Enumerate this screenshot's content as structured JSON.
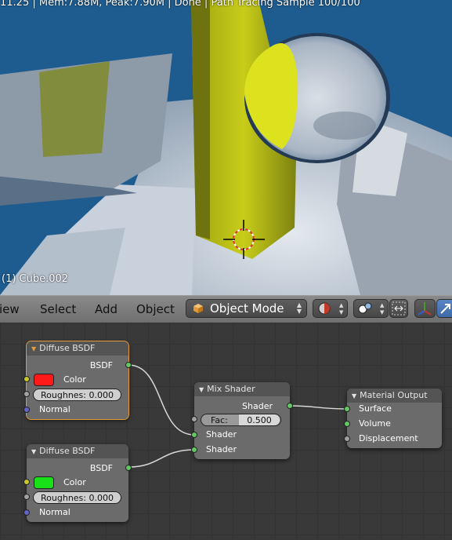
{
  "viewport": {
    "status_text": "11.25 | Mem:7.88M, Peak:7.90M | Done | Path Tracing Sample 100/100",
    "object_label": "(1) Cube.002"
  },
  "header": {
    "menus": [
      "iew",
      "Select",
      "Add",
      "Object"
    ],
    "mode": "Object Mode",
    "icons": [
      "cube-icon",
      "viewport-shading-icon",
      "pivot-icon",
      "snap-icon",
      "manipulator-icon",
      "translate-icon"
    ]
  },
  "nodes": {
    "diffuse1": {
      "title": "Diffuse BSDF",
      "output": "BSDF",
      "color_label": "Color",
      "color": "#ff1a1a",
      "roughness": "Roughnes: 0.000",
      "normal": "Normal"
    },
    "diffuse2": {
      "title": "Diffuse BSDF",
      "output": "BSDF",
      "color_label": "Color",
      "color": "#18e018",
      "roughness": "Roughnes: 0.000",
      "normal": "Normal"
    },
    "mix": {
      "title": "Mix Shader",
      "output": "Shader",
      "fac_label": "Fac:",
      "fac_value": "0.500",
      "input1": "Shader",
      "input2": "Shader"
    },
    "output": {
      "title": "Material Output",
      "surface": "Surface",
      "volume": "Volume",
      "displacement": "Displacement"
    }
  },
  "colors": {
    "accent_active": "#e39b3b",
    "socket_shader": "#63c763",
    "socket_color": "#c7c729",
    "socket_float": "#a1a1a1",
    "socket_vector": "#6363c7"
  }
}
